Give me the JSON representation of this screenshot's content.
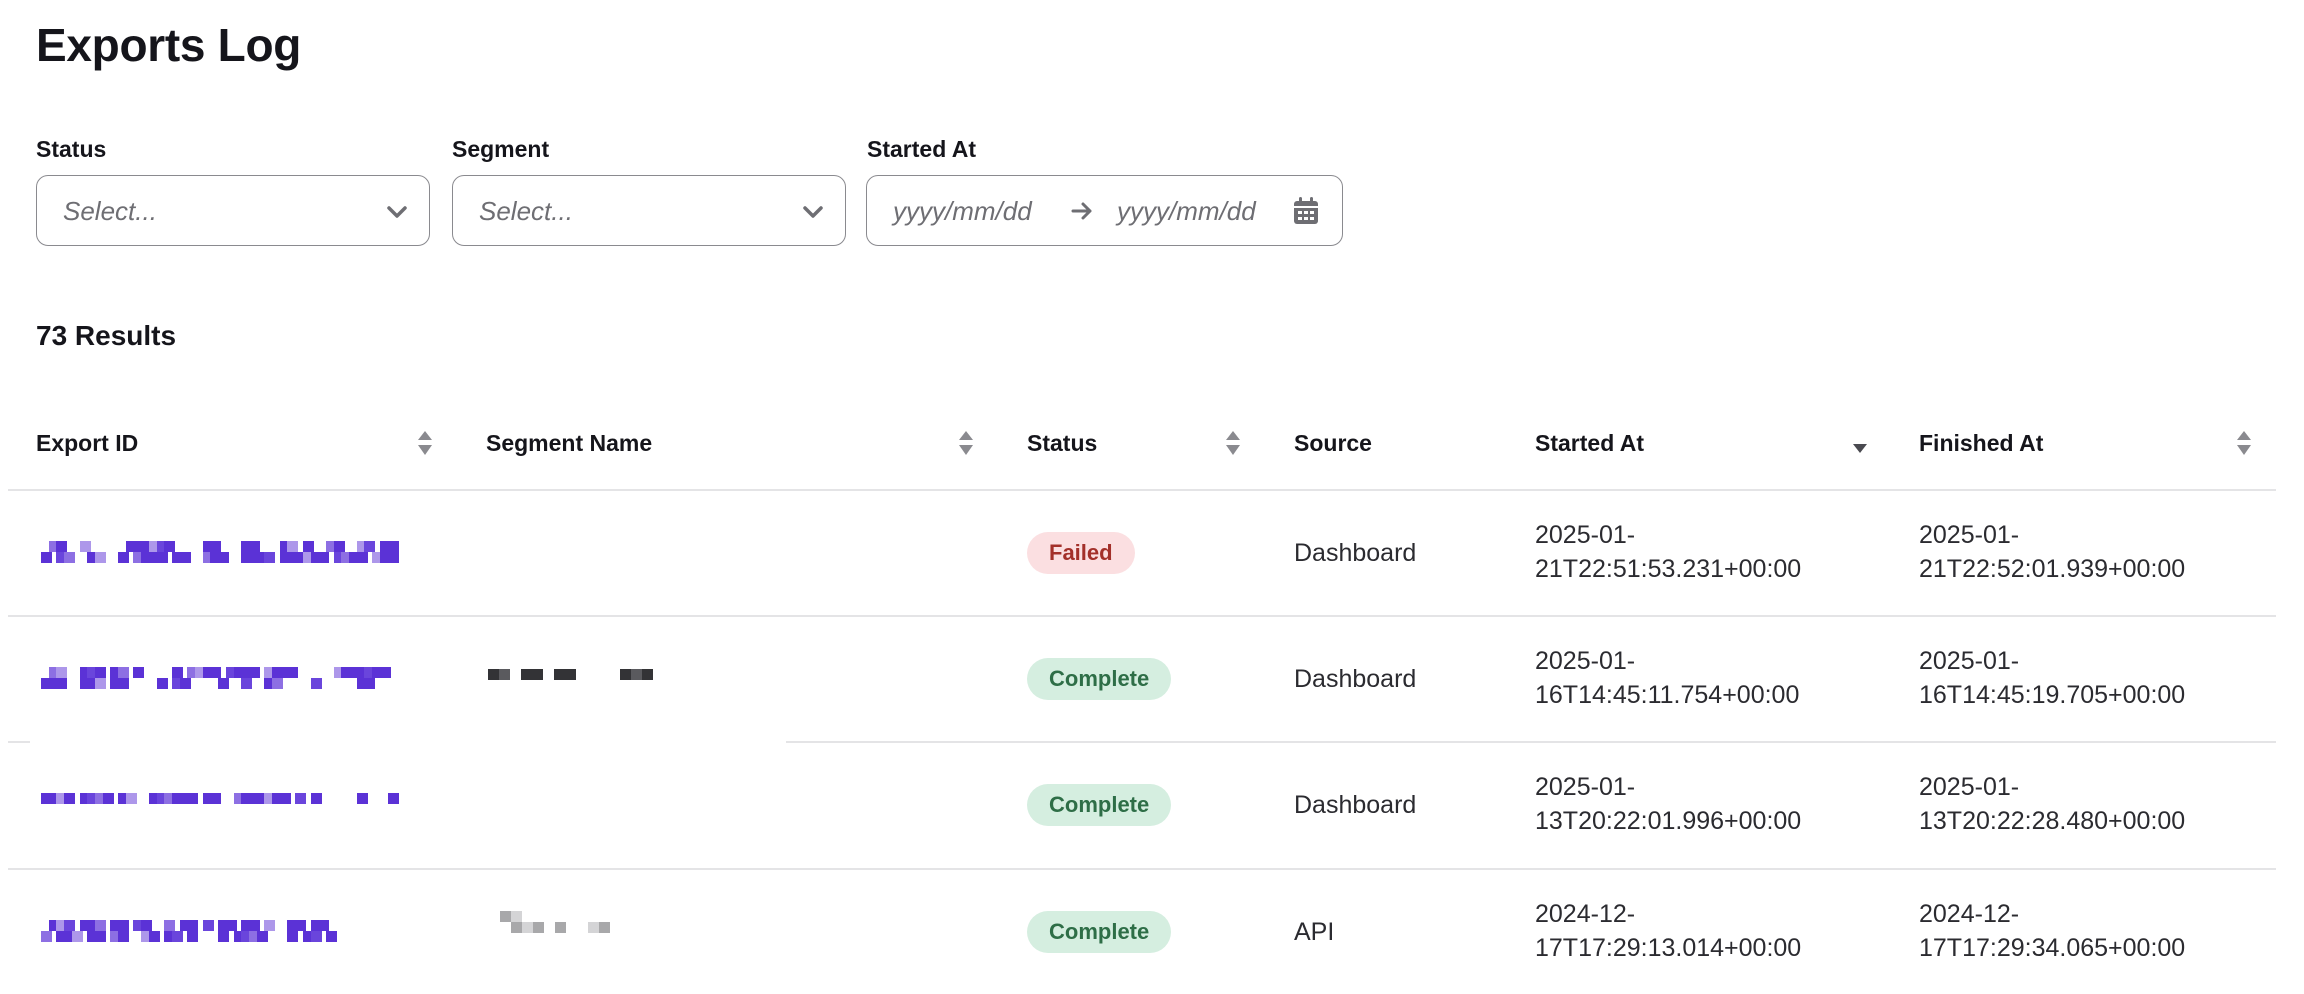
{
  "page": {
    "title": "Exports Log"
  },
  "filters": {
    "status": {
      "label": "Status",
      "placeholder": "Select..."
    },
    "segment": {
      "label": "Segment",
      "placeholder": "Select..."
    },
    "started_at": {
      "label": "Started At",
      "start_placeholder": "yyyy/mm/dd",
      "end_placeholder": "yyyy/mm/dd"
    }
  },
  "results": {
    "count_label": "73 Results"
  },
  "table": {
    "columns": [
      {
        "label": "Export ID",
        "sort": "none"
      },
      {
        "label": "Segment Name",
        "sort": "none"
      },
      {
        "label": "Status",
        "sort": "none"
      },
      {
        "label": "Source",
        "sort": null
      },
      {
        "label": "Started At",
        "sort": "descending"
      },
      {
        "label": "Finished At",
        "sort": "none"
      }
    ],
    "rows": [
      {
        "export_id": "[redacted]",
        "segment_name": "",
        "status": "Failed",
        "status_kind": "failed",
        "source": "Dashboard",
        "started_at": [
          "2025-01-",
          "21T22:51:53.231+00:00"
        ],
        "finished_at": [
          "2025-01-",
          "21T22:52:01.939+00:00"
        ]
      },
      {
        "export_id": "[redacted]",
        "segment_name": "[redacted]",
        "status": "Complete",
        "status_kind": "complete",
        "source": "Dashboard",
        "started_at": [
          "2025-01-",
          "16T14:45:11.754+00:00"
        ],
        "finished_at": [
          "2025-01-",
          "16T14:45:19.705+00:00"
        ]
      },
      {
        "export_id": "[redacted]",
        "segment_name": "",
        "status": "Complete",
        "status_kind": "complete",
        "source": "Dashboard",
        "started_at": [
          "2025-01-",
          "13T20:22:01.996+00:00"
        ],
        "finished_at": [
          "2025-01-",
          "13T20:22:28.480+00:00"
        ]
      },
      {
        "export_id": "[redacted]",
        "segment_name": "[redacted]",
        "status": "Complete",
        "status_kind": "complete",
        "source": "API",
        "started_at": [
          "2024-12-",
          "17T17:29:13.014+00:00"
        ],
        "finished_at": [
          "2024-12-",
          "17T17:29:34.065+00:00"
        ]
      }
    ]
  },
  "icons": {
    "select_chevron": "chevron-down-icon",
    "range_arrow": "arrow-right-icon",
    "calendar": "calendar-icon",
    "sort_both": "sort-icon",
    "sort_desc": "sort-descending-icon"
  },
  "colors": {
    "redaction_purple": "#5b32d6",
    "failed_bg": "#fbdfe1",
    "failed_text": "#a3302a",
    "complete_bg": "#d5eee0",
    "complete_text": "#2e6e47"
  }
}
